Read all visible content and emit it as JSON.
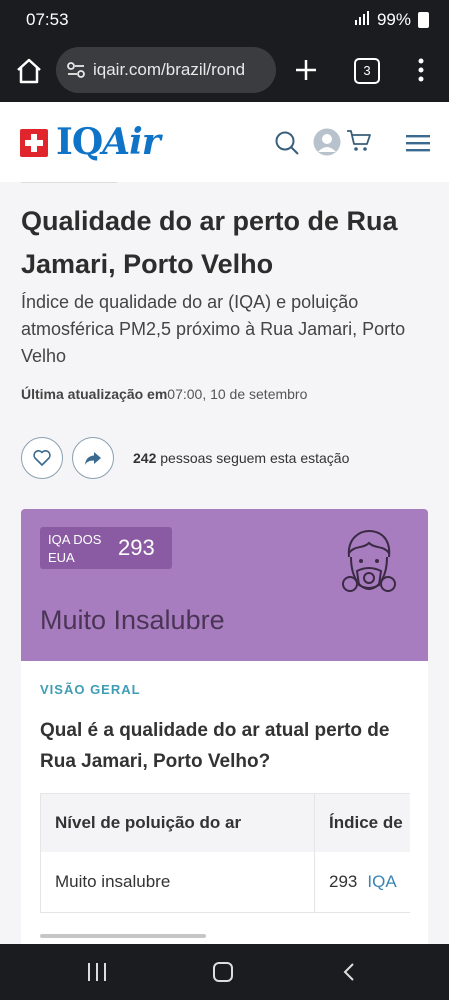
{
  "status_bar": {
    "time": "07:53",
    "battery": "99%"
  },
  "browser": {
    "url": "iqair.com/brazil/rond",
    "tab_count": "3"
  },
  "site": {
    "logo_iq": "IQ",
    "logo_air": "Air"
  },
  "page": {
    "title": "Qualidade do ar perto de Rua Jamari, Porto Velho",
    "subtitle": "Índice de qualidade do ar (IQA) e poluição atmosférica PM2,5 próximo à Rua Jamari, Porto Velho",
    "updated_label": "Última atualização em",
    "updated_value": "07:00, 10 de setembro",
    "followers_count": "242",
    "followers_text": " pessoas seguem esta estação"
  },
  "aqi_card": {
    "badge_label": "IQA DOS EUA",
    "value": "293",
    "status": "Muito Insalubre",
    "color": "#a87dbf",
    "badge_color": "#8a5ba3"
  },
  "overview": {
    "section_label": "VISÃO GERAL",
    "question": "Qual é a qualidade do ar atual perto de Rua Jamari, Porto Velho?",
    "table": {
      "headers": [
        "Nível de poluição do ar",
        "Índice de"
      ],
      "rows": [
        {
          "level": "Muito insalubre",
          "index": "293",
          "unit": "IQA"
        }
      ]
    }
  },
  "icons": {
    "home": "home-icon",
    "tune": "site-settings-icon",
    "plus": "new-tab-icon",
    "menu": "more-vert-icon",
    "search": "search-icon",
    "avatar": "user-avatar-icon",
    "cart": "cart-icon",
    "hamburger": "hamburger-menu-icon",
    "heart": "heart-icon",
    "share": "share-icon",
    "mask": "gas-mask-person-icon"
  }
}
